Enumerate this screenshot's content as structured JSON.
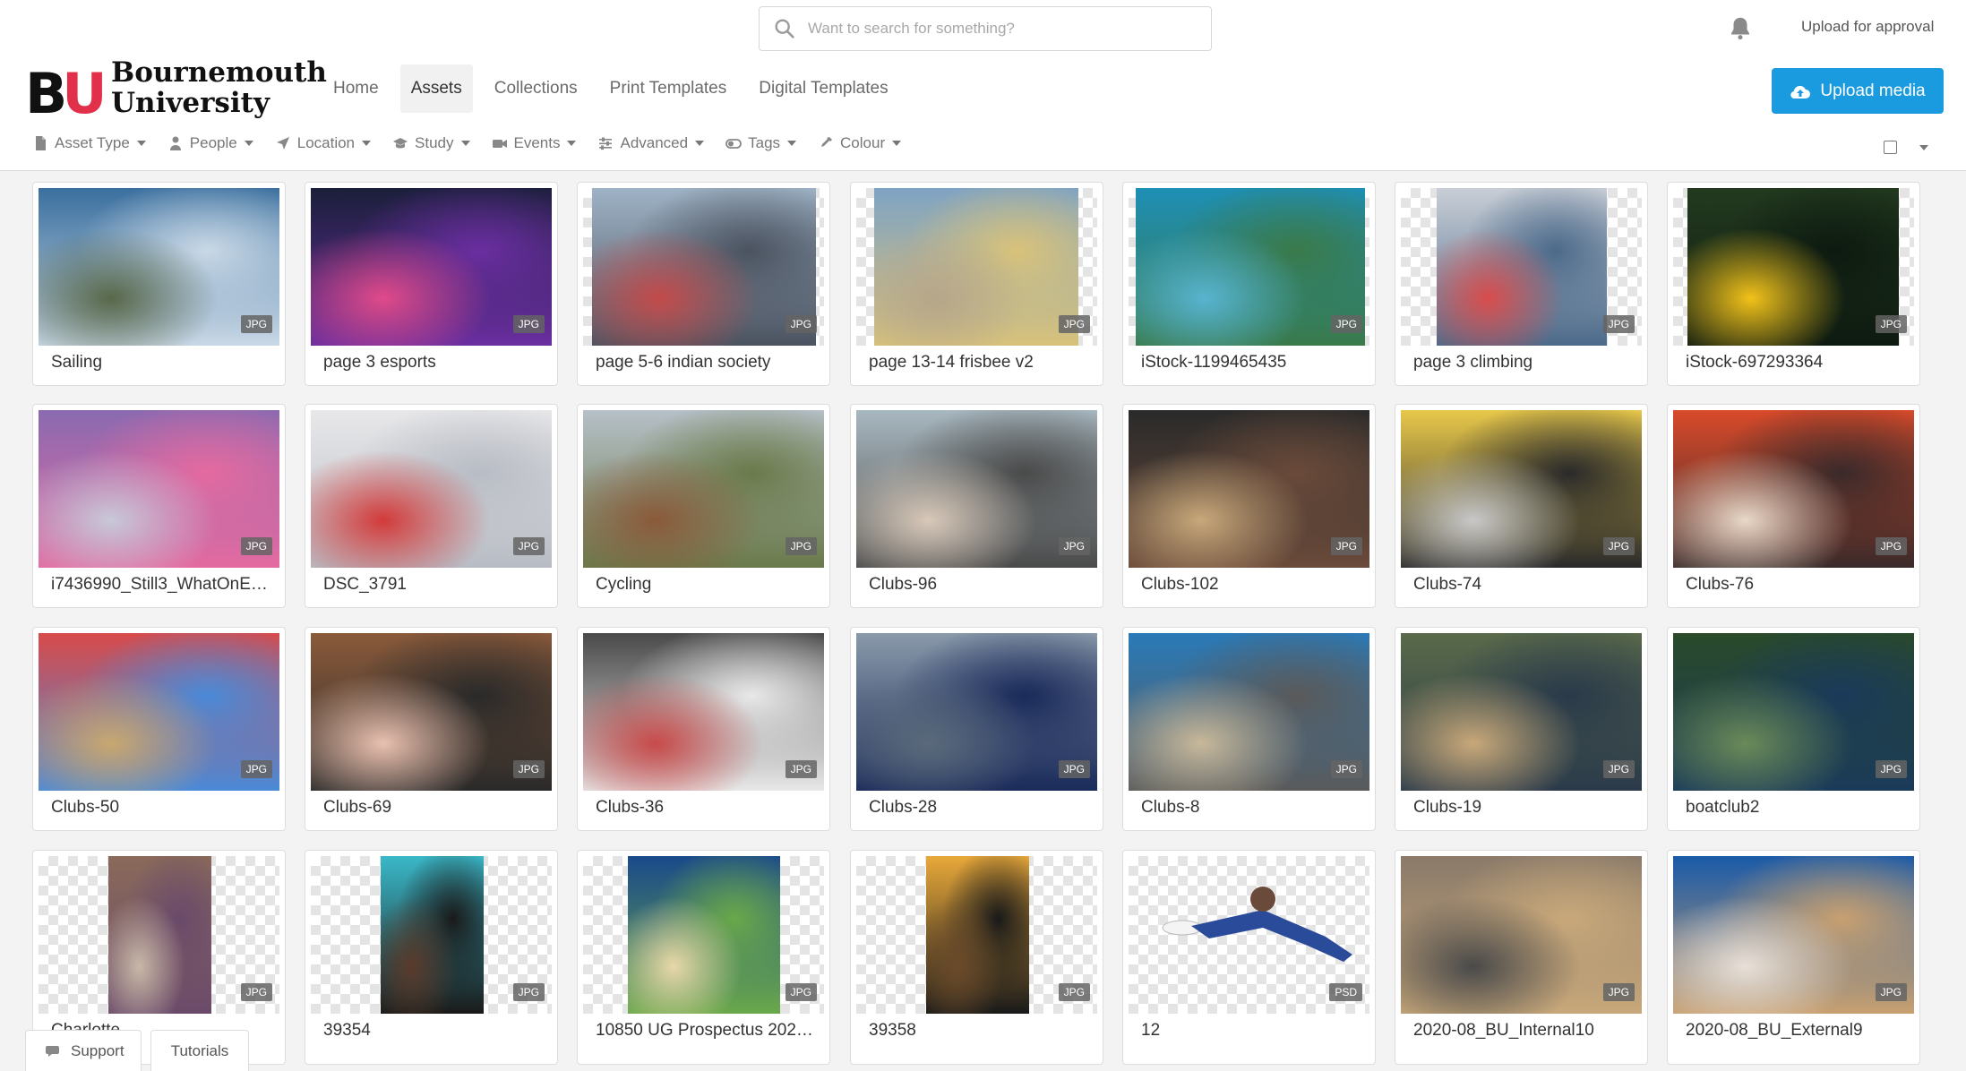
{
  "header": {
    "search_placeholder": "Want to search for something?",
    "upload_for_approval": "Upload for approval",
    "logo_letters": "BU",
    "logo_line1": "Bournemouth",
    "logo_line2": "University",
    "upload_button": "Upload media",
    "nav": [
      {
        "label": "Home",
        "active": false
      },
      {
        "label": "Assets",
        "active": true
      },
      {
        "label": "Collections",
        "active": false
      },
      {
        "label": "Print Templates",
        "active": false
      },
      {
        "label": "Digital Templates",
        "active": false
      }
    ],
    "filters": [
      {
        "label": "Asset Type",
        "icon": "file-icon"
      },
      {
        "label": "People",
        "icon": "person-icon"
      },
      {
        "label": "Location",
        "icon": "location-arrow-icon"
      },
      {
        "label": "Study",
        "icon": "graduation-cap-icon"
      },
      {
        "label": "Events",
        "icon": "video-camera-icon"
      },
      {
        "label": "Advanced",
        "icon": "sliders-icon"
      },
      {
        "label": "Tags",
        "icon": "toggle-icon"
      },
      {
        "label": "Colour",
        "icon": "eyedropper-icon"
      }
    ]
  },
  "colors": {
    "accent": "#1a9be0",
    "logo_red": "#e2304a",
    "text": "#333333",
    "muted": "#777777"
  },
  "assets": [
    {
      "name": "Sailing",
      "type": "JPG",
      "colors": [
        "#3a6f9e",
        "#c9d8e6",
        "#59684a"
      ]
    },
    {
      "name": "page 3 esports",
      "type": "JPG",
      "colors": [
        "#1a1f3a",
        "#6a2ea0",
        "#e04a8a"
      ]
    },
    {
      "name": "page 5-6 indian society",
      "type": "JPG",
      "colors": [
        "#9fb3c6",
        "#4b5360",
        "#c34a4a"
      ]
    },
    {
      "name": "page 13-14 frisbee v2",
      "type": "JPG",
      "colors": [
        "#7fa3c4",
        "#d8c27a",
        "#b7a68a"
      ]
    },
    {
      "name": "iStock-1199465435",
      "type": "JPG",
      "colors": [
        "#1e8fb6",
        "#3a7a4a",
        "#58b4cf"
      ]
    },
    {
      "name": "page 3 climbing",
      "type": "JPG",
      "colors": [
        "#c9ced6",
        "#4c6a8a",
        "#d84c4c"
      ]
    },
    {
      "name": "iStock-697293364",
      "type": "JPG",
      "colors": [
        "#233a1f",
        "#0d1a10",
        "#f2c21a"
      ]
    },
    {
      "name": "i7436990_Still3_WhatOnE…",
      "type": "JPG",
      "colors": [
        "#8a6ab0",
        "#e46aa0",
        "#c8c8d8"
      ]
    },
    {
      "name": "DSC_3791",
      "type": "JPG",
      "colors": [
        "#e8e8ea",
        "#b8bcc4",
        "#d23a3a"
      ]
    },
    {
      "name": "Cycling",
      "type": "JPG",
      "colors": [
        "#b6c0c8",
        "#6a7a4a",
        "#8a5a3a"
      ]
    },
    {
      "name": "Clubs-96",
      "type": "JPG",
      "colors": [
        "#a8b8c0",
        "#4a4a4a",
        "#d8c8b8"
      ]
    },
    {
      "name": "Clubs-102",
      "type": "JPG",
      "colors": [
        "#2a2a2a",
        "#6a4a3a",
        "#c8a87a"
      ]
    },
    {
      "name": "Clubs-74",
      "type": "JPG",
      "colors": [
        "#e8c84a",
        "#2a2a2a",
        "#c8c8c8"
      ]
    },
    {
      "name": "Clubs-76",
      "type": "JPG",
      "colors": [
        "#d84a2a",
        "#3a2a2a",
        "#e8d8c8"
      ]
    },
    {
      "name": "Clubs-50",
      "type": "JPG",
      "colors": [
        "#d84a4a",
        "#4a8ad8",
        "#c8a870"
      ]
    },
    {
      "name": "Clubs-69",
      "type": "JPG",
      "colors": [
        "#8a5a3a",
        "#2a2a2a",
        "#e8c0b0"
      ]
    },
    {
      "name": "Clubs-36",
      "type": "JPG",
      "colors": [
        "#4a4a4a",
        "#e8e8e8",
        "#c84a4a"
      ]
    },
    {
      "name": "Clubs-28",
      "type": "JPG",
      "colors": [
        "#8a9aaa",
        "#1a2a5a",
        "#5a6a7a"
      ]
    },
    {
      "name": "Clubs-8",
      "type": "JPG",
      "colors": [
        "#2a7ab8",
        "#5a5a5a",
        "#c8b89a"
      ]
    },
    {
      "name": "Clubs-19",
      "type": "JPG",
      "colors": [
        "#5a6a4a",
        "#2a3a4a",
        "#c8a87a"
      ]
    },
    {
      "name": "boatclub2",
      "type": "JPG",
      "colors": [
        "#2a4a2a",
        "#1a3a5a",
        "#6a8a5a"
      ]
    },
    {
      "name": "Charlotte",
      "type": "JPG",
      "colors": [
        "#8a6a5a",
        "#6a4a6a",
        "#c8b8a8"
      ]
    },
    {
      "name": "39354",
      "type": "JPG",
      "colors": [
        "#3ab8c8",
        "#1a1a1a",
        "#5a3a2a"
      ]
    },
    {
      "name": "10850 UG Prospectus 202…",
      "type": "JPG",
      "colors": [
        "#1a4a8a",
        "#6aa84a",
        "#e8d8a8"
      ]
    },
    {
      "name": "39358",
      "type": "JPG",
      "colors": [
        "#e8a83a",
        "#1a1a1a",
        "#6a4a2a"
      ]
    },
    {
      "name": "12",
      "type": "PSD",
      "colors": [
        "#ffffff",
        "#2a4a9a",
        "#6a4a3a"
      ]
    },
    {
      "name": "2020-08_BU_Internal10",
      "type": "JPG",
      "colors": [
        "#8a7a6a",
        "#c8a87a",
        "#4a4a4a"
      ]
    },
    {
      "name": "2020-08_BU_External9",
      "type": "JPG",
      "colors": [
        "#1a5aa8",
        "#c8a070",
        "#e8e0d8"
      ]
    }
  ],
  "bottom_tabs": {
    "support": "Support",
    "tutorials": "Tutorials"
  }
}
